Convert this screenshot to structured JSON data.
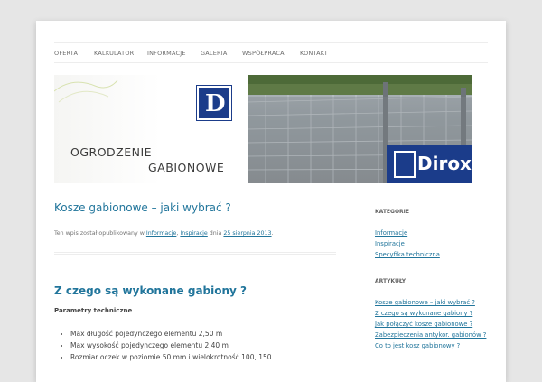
{
  "nav": {
    "items": [
      "OFERTA",
      "KALKULATOR",
      "INFORMACJE",
      "GALERIA",
      "WSPÓŁPRACA",
      "KONTAKT"
    ]
  },
  "banner": {
    "line1": "OGRODZENIE",
    "line2": "GABIONOWE",
    "logo_letter": "D",
    "brand": "Dirox"
  },
  "post": {
    "title": "Kosze gabionowe – jaki wybrać ?",
    "meta_prefix": "Ten wpis został opublikowany w ",
    "meta_cat1": "Informacje",
    "meta_sep": ", ",
    "meta_cat2": "Inspiracje",
    "meta_mid": " dnia ",
    "meta_date": "25 sierpnia 2013",
    "meta_suffix": ". ."
  },
  "post2": {
    "title": "Z czego są wykonane gabiony ?",
    "subheading": "Parametry techniczne",
    "list": [
      "Max długość pojedynczego elementu 2,50 m",
      "Max wysokość pojedynczego elementu 2,40 m",
      "Rozmiar oczek w poziomie 50 mm i wielokrotność 100, 150"
    ]
  },
  "sidebar": {
    "categories_title": "KATEGORIE",
    "categories": [
      "Informacje",
      "Inspiracje",
      "Specyfika techniczna"
    ],
    "articles_title": "ARTYKUŁY",
    "articles": [
      "Kosze gabionowe – jaki wybrać ?",
      "Z czego są wykonane gabiony ?",
      "Jak połączyć kosze gabionowe ?",
      "Zabezpieczenia antykor. gabionów ?",
      "Co to jest kosz gabionowy ?"
    ]
  }
}
